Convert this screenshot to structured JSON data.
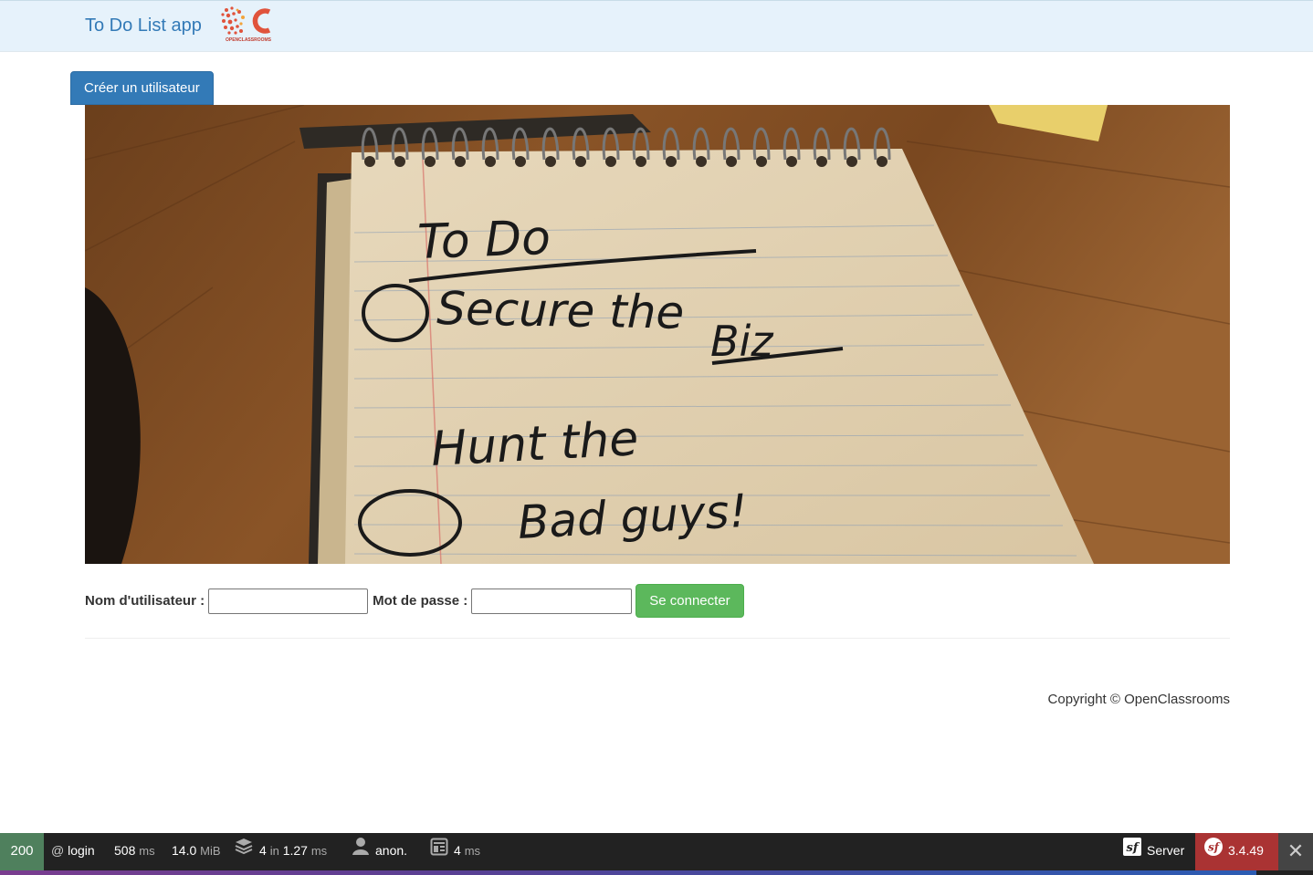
{
  "navbar": {
    "brand_label": "To Do List app",
    "logo_name": "openclassrooms-logo",
    "logo_text": "OPENCLASSROOMS"
  },
  "actions": {
    "create_user_label": "Créer un utilisateur"
  },
  "hero": {
    "description": "notepad-with-handwritten-todo",
    "handwritten_lines": [
      "To Do",
      "Secure the",
      "Biz",
      "Hunt the",
      "Bad guys!"
    ]
  },
  "login_form": {
    "username_label": "Nom d'utilisateur :",
    "username_value": "",
    "password_label": "Mot de passe :",
    "password_value": "",
    "submit_label": "Se connecter"
  },
  "footer": {
    "copyright": "Copyright © OpenClassrooms"
  },
  "debug_toolbar": {
    "status_code": "200",
    "route_prefix": "@",
    "route": "login",
    "time_value": "508",
    "time_unit": "ms",
    "memory_value": "14.0",
    "memory_unit": "MiB",
    "db_queries": "4",
    "db_in": "in",
    "db_time": "1.27",
    "db_unit": "ms",
    "user": "anon.",
    "twig_time": "4",
    "twig_unit": "ms",
    "server_label": "Server",
    "symfony_version": "3.4.49",
    "close_symbol": "✕",
    "colors": {
      "status_bg": "#4f805d",
      "version_bg": "#aa3333",
      "toolbar_bg": "#222222"
    }
  },
  "colors": {
    "navbar_bg": "#e6f2fb",
    "primary": "#337ab7",
    "success": "#5cb85c"
  }
}
